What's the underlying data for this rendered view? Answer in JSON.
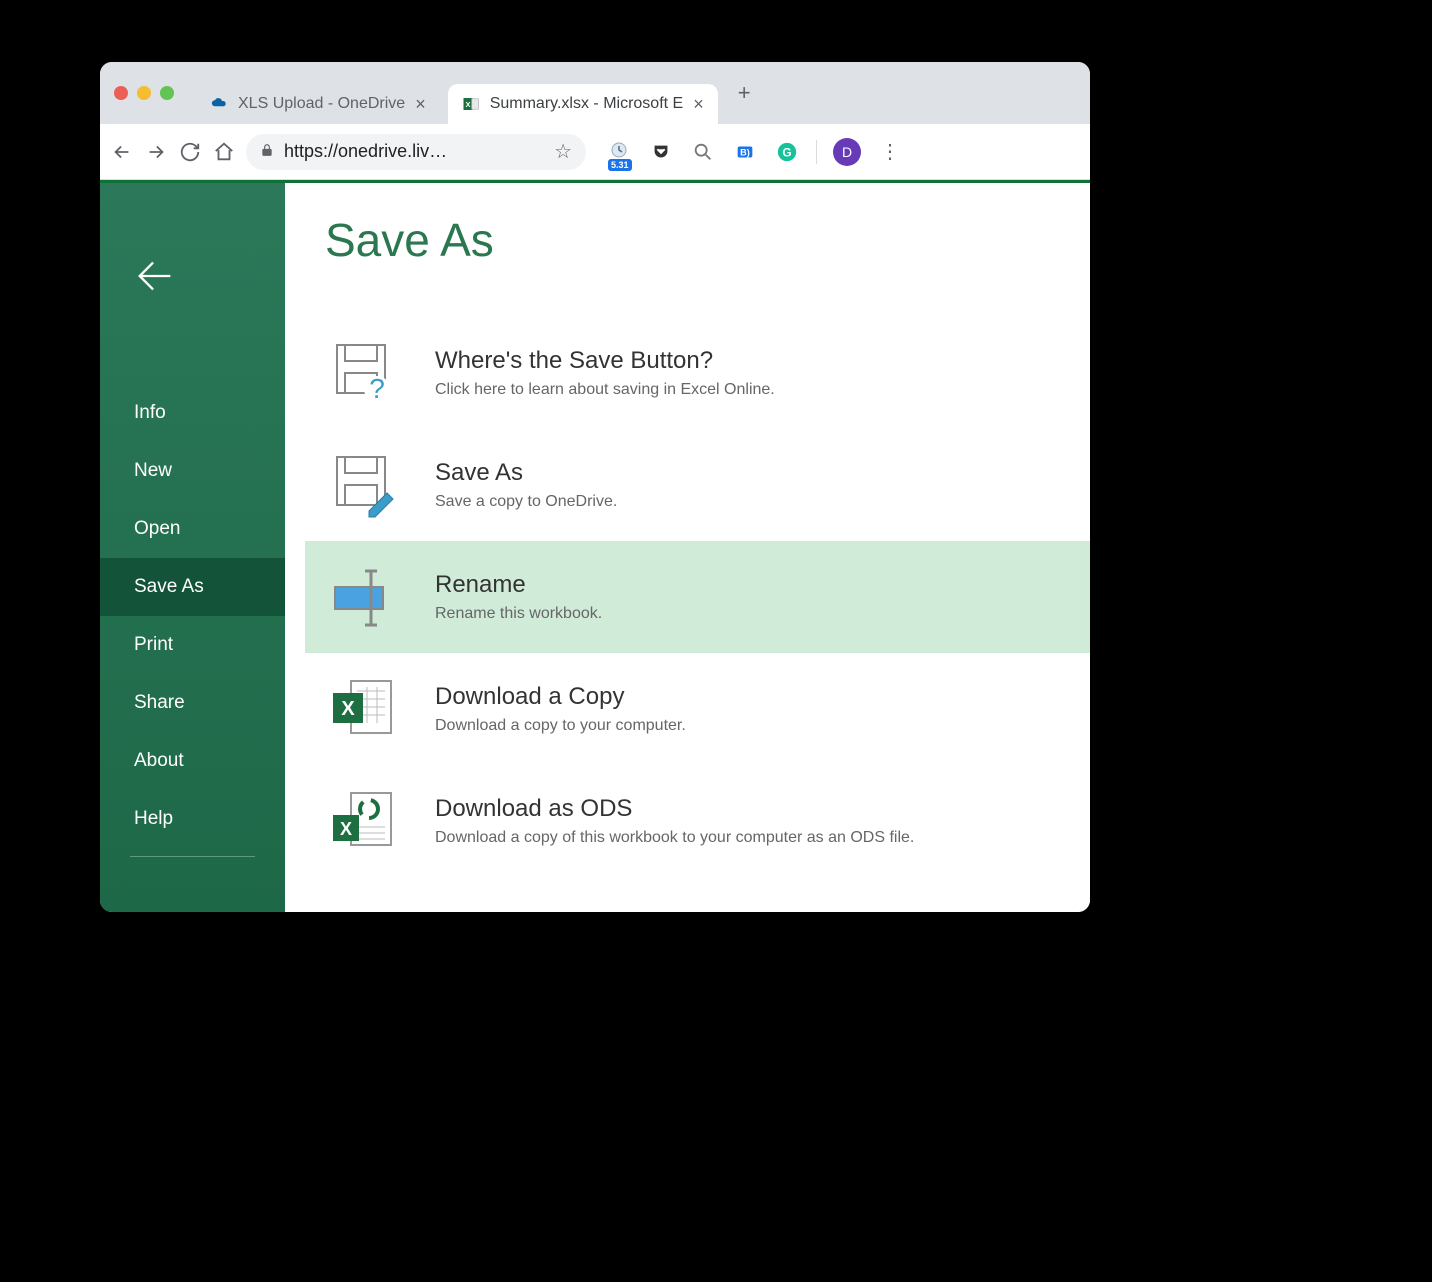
{
  "browser": {
    "tabs": [
      {
        "title": "XLS Upload - OneDrive",
        "active": false
      },
      {
        "title": "Summary.xlsx - Microsoft E",
        "active": true
      }
    ],
    "url": "https://onedrive.liv…",
    "extension_badge": "5.31",
    "avatar_initial": "D"
  },
  "page": {
    "title": "Save As",
    "sidebar": {
      "items": [
        {
          "label": "Info",
          "active": false
        },
        {
          "label": "New",
          "active": false
        },
        {
          "label": "Open",
          "active": false
        },
        {
          "label": "Save As",
          "active": true
        },
        {
          "label": "Print",
          "active": false
        },
        {
          "label": "Share",
          "active": false
        },
        {
          "label": "About",
          "active": false
        },
        {
          "label": "Help",
          "active": false
        }
      ]
    },
    "options": [
      {
        "title": "Where's the Save Button?",
        "desc": "Click here to learn about saving in Excel Online.",
        "highlighted": false,
        "icon": "save-question"
      },
      {
        "title": "Save As",
        "desc": "Save a copy to OneDrive.",
        "highlighted": false,
        "icon": "save-pencil"
      },
      {
        "title": "Rename",
        "desc": "Rename this workbook.",
        "highlighted": true,
        "icon": "rename"
      },
      {
        "title": "Download a Copy",
        "desc": "Download a copy to your computer.",
        "highlighted": false,
        "icon": "excel-download"
      },
      {
        "title": "Download as ODS",
        "desc": "Download a copy of this workbook to your computer as an ODS file.",
        "highlighted": false,
        "icon": "excel-ods"
      }
    ]
  }
}
